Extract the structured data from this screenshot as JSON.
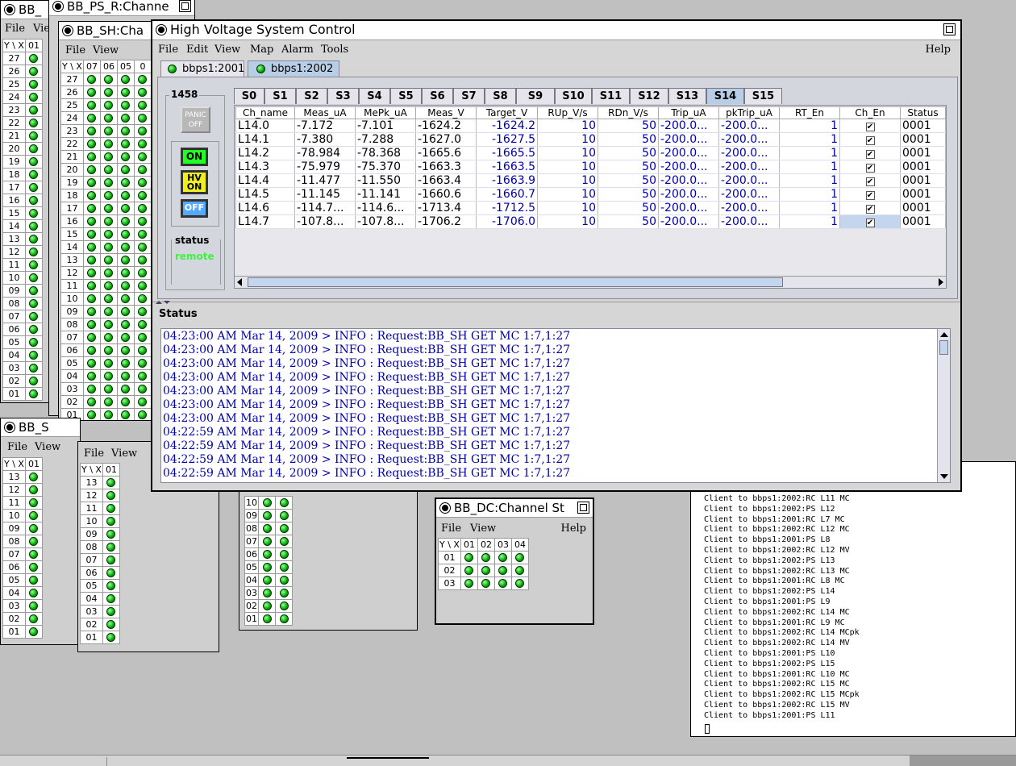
{
  "win_bb1": {
    "title": "BB_",
    "menu": [
      "File",
      "Vie"
    ],
    "header": [
      "Y \\ X",
      "01"
    ],
    "rows": [
      "27",
      "26",
      "25",
      "24",
      "23",
      "22",
      "21",
      "20",
      "19",
      "18",
      "17",
      "16",
      "15",
      "14",
      "13",
      "12",
      "11",
      "10",
      "09",
      "08",
      "07",
      "06",
      "05",
      "04",
      "03",
      "02",
      "01"
    ]
  },
  "win_ps_r": {
    "title": "BB_PS_R:Channe"
  },
  "win_sh": {
    "title": "BB_SH:Cha",
    "menu": [
      "File",
      "View"
    ],
    "header": [
      "Y \\ X",
      "07",
      "06",
      "05",
      "0"
    ],
    "rows": [
      "27",
      "26",
      "25",
      "24",
      "23",
      "22",
      "21",
      "20",
      "19",
      "18",
      "17",
      "16",
      "15",
      "14",
      "13",
      "12",
      "11",
      "10",
      "09",
      "08",
      "07",
      "06",
      "05",
      "04",
      "03",
      "02",
      "01"
    ]
  },
  "win_bbs": {
    "title": "BB_S",
    "menu": [
      "File",
      "View"
    ],
    "header": [
      "Y \\ X",
      "01"
    ],
    "rows": [
      "13",
      "12",
      "11",
      "10",
      "09",
      "08",
      "07",
      "06",
      "05",
      "04",
      "03",
      "02",
      "01"
    ]
  },
  "win_small2": {
    "menu": [
      "File",
      "View"
    ],
    "header": [
      "Y \\ X",
      "01"
    ],
    "rows": [
      "13",
      "12",
      "11",
      "10",
      "09",
      "08",
      "07",
      "06",
      "05",
      "04",
      "03",
      "02",
      "01"
    ]
  },
  "win_mid": {
    "rows": [
      "10",
      "09",
      "08",
      "07",
      "06",
      "05",
      "04",
      "03",
      "02",
      "01"
    ]
  },
  "win_dc": {
    "title": "BB_DC:Channel St",
    "menu": [
      "File",
      "View"
    ],
    "help": "Help",
    "header": [
      "Y \\ X",
      "01",
      "02",
      "03",
      "04"
    ],
    "rows": [
      "01",
      "02",
      "03"
    ]
  },
  "hv": {
    "title": "High Voltage System Control",
    "menu": [
      "File",
      "Edit",
      "View",
      "Map",
      "Alarm",
      "Tools"
    ],
    "help": "Help",
    "crate_tabs": [
      "bbps1:2001",
      "bbps1:2002"
    ],
    "crate_number": "1458",
    "panic_label": "PANIC OFF",
    "on_label": "ON",
    "hv_on_label": "HV ON",
    "off_label": "OFF",
    "status_label": "status",
    "status_value": "remote",
    "slot_tabs": [
      "S0",
      "S1",
      "S2",
      "S3",
      "S4",
      "S5",
      "S6",
      "S7",
      "S8",
      "S9",
      "S10",
      "S11",
      "S12",
      "S13",
      "S14",
      "S15"
    ],
    "selected_slot": "S14",
    "columns": [
      "Ch_name",
      "Meas_uA",
      "MePk_uA",
      "Meas_V",
      "Target_V",
      "RUp_V/s",
      "RDn_V/s",
      "Trip_uA",
      "pkTrip_uA",
      "RT_En",
      "Ch_En",
      "Status"
    ],
    "rows": [
      [
        "L14.0",
        "-7.172",
        "-7.101",
        "-1624.2",
        "-1624.2",
        "10",
        "50",
        "-200.0...",
        "-200.0...",
        "1",
        "✔",
        "0001"
      ],
      [
        "L14.1",
        "-7.380",
        "-7.288",
        "-1627.0",
        "-1627.5",
        "10",
        "50",
        "-200.0...",
        "-200.0...",
        "1",
        "✔",
        "0001"
      ],
      [
        "L14.2",
        "-78.984",
        "-78.368",
        "-1665.6",
        "-1665.5",
        "10",
        "50",
        "-200.0...",
        "-200.0...",
        "1",
        "✔",
        "0001"
      ],
      [
        "L14.3",
        "-75.979",
        "-75.370",
        "-1663.3",
        "-1663.5",
        "10",
        "50",
        "-200.0...",
        "-200.0...",
        "1",
        "✔",
        "0001"
      ],
      [
        "L14.4",
        "-11.477",
        "-11.550",
        "-1663.4",
        "-1663.9",
        "10",
        "50",
        "-200.0...",
        "-200.0...",
        "1",
        "✔",
        "0001"
      ],
      [
        "L14.5",
        "-11.145",
        "-11.141",
        "-1660.6",
        "-1660.7",
        "10",
        "50",
        "-200.0...",
        "-200.0...",
        "1",
        "✔",
        "0001"
      ],
      [
        "L14.6",
        "-114.7...",
        "-114.6...",
        "-1713.4",
        "-1712.5",
        "10",
        "50",
        "-200.0...",
        "-200.0...",
        "1",
        "✔",
        "0001"
      ],
      [
        "L14.7",
        "-107.8...",
        "-107.8...",
        "-1706.2",
        "-1706.0",
        "10",
        "50",
        "-200.0...",
        "-200.0...",
        "1",
        "✔",
        "0001"
      ]
    ],
    "status_pane_label": "Status",
    "log": [
      "04:23:00 AM Mar 14, 2009 > INFO : Request:BB_SH GET MC 1:7,1:27",
      "04:23:00 AM Mar 14, 2009 > INFO : Request:BB_SH GET MC 1:7,1:27",
      "04:23:00 AM Mar 14, 2009 > INFO : Request:BB_SH GET MC 1:7,1:27",
      "04:23:00 AM Mar 14, 2009 > INFO : Request:BB_SH GET MC 1:7,1:27",
      "04:23:00 AM Mar 14, 2009 > INFO : Request:BB_SH GET MC 1:7,1:27",
      "04:23:00 AM Mar 14, 2009 > INFO : Request:BB_SH GET MC 1:7,1:27",
      "04:23:00 AM Mar 14, 2009 > INFO : Request:BB_SH GET MC 1:7,1:27",
      "04:22:59 AM Mar 14, 2009 > INFO : Request:BB_SH GET MC 1:7,1:27",
      "04:22:59 AM Mar 14, 2009 > INFO : Request:BB_SH GET MC 1:7,1:27",
      "04:22:59 AM Mar 14, 2009 > INFO : Request:BB_SH GET MC 1:7,1:27",
      "04:22:59 AM Mar 14, 2009 > INFO : Request:BB_SH GET MC 1:7,1:27"
    ]
  },
  "terminal": {
    "lines": [
      "Client to bbps1:2002:RC L11 MC",
      "Client to bbps1:2002:PS L12",
      "Client to bbps1:2001:RC L7 MC",
      "Client to bbps1:2002:RC L12 MC",
      "Client to bbps1:2001:PS L8",
      "Client to bbps1:2002:RC L12 MV",
      "Client to bbps1:2002:PS L13",
      "Client to bbps1:2002:RC L13 MC",
      "Client to bbps1:2001:RC L8 MC",
      "Client to bbps1:2002:PS L14",
      "Client to bbps1:2001:PS L9",
      "Client to bbps1:2002:RC L14 MC",
      "Client to bbps1:2001:RC L9 MC",
      "Client to bbps1:2002:RC L14 MCpk",
      "Client to bbps1:2002:RC L14 MV",
      "Client to bbps1:2001:PS L10",
      "Client to bbps1:2002:PS L15",
      "Client to bbps1:2001:RC L10 MC",
      "Client to bbps1:2002:RC L15 MC",
      "Client to bbps1:2002:RC L15 MCpk",
      "Client to bbps1:2002:RC L15 MV",
      "Client to bbps1:2001:PS L11"
    ]
  }
}
